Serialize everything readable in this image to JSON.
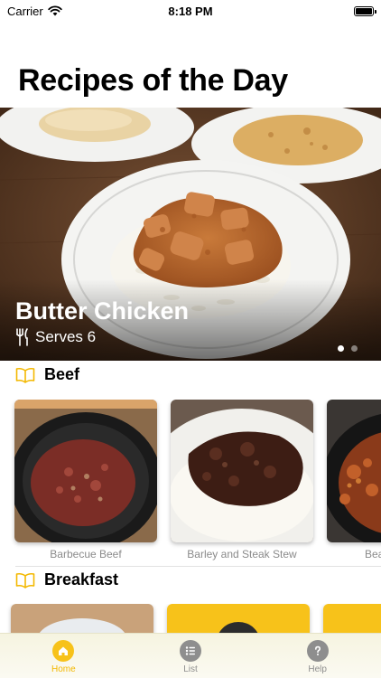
{
  "status_bar": {
    "carrier": "Carrier",
    "time": "8:18 PM"
  },
  "page_title": "Recipes of the Day",
  "featured": {
    "title": "Butter Chicken",
    "serves": "Serves 6",
    "page_count": 2,
    "current_page": 1
  },
  "sections": [
    {
      "title": "Beef",
      "recipes": [
        {
          "name": "Barbecue Beef"
        },
        {
          "name": "Barley and Steak Stew"
        },
        {
          "name": "Bea"
        }
      ]
    },
    {
      "title": "Breakfast",
      "recipes": []
    }
  ],
  "tabs": [
    {
      "label": "Home",
      "icon": "home-icon",
      "active": true
    },
    {
      "label": "List",
      "icon": "list-icon",
      "active": false
    },
    {
      "label": "Help",
      "icon": "help-icon",
      "active": false
    }
  ],
  "colors": {
    "accent": "#F7C21A",
    "tab_inactive": "#8E8E8E"
  }
}
